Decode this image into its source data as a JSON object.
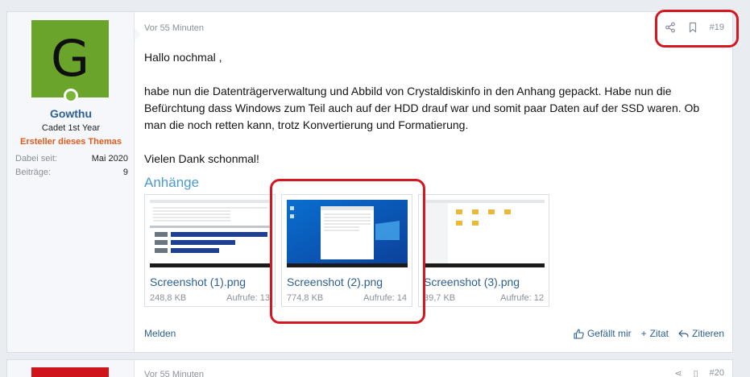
{
  "post": {
    "time": "Vor 55 Minuten",
    "number": "#19",
    "user": {
      "avatar_letter": "G",
      "name": "Gowthu",
      "title": "Cadet 1st Year",
      "badge": "Ersteller dieses Themas",
      "stats": [
        {
          "key": "Dabei seit:",
          "value": "Mai 2020"
        },
        {
          "key": "Beiträge:",
          "value": "9"
        }
      ]
    },
    "message": {
      "line1": "Hallo nochmal ,",
      "line2": "habe nun die Datenträgerverwaltung und Abbild von Crystaldiskinfo in den Anhang gepackt. Habe nun die Befürchtung dass Windows zum Teil auch auf der HDD drauf war und somit paar Daten auf der SSD waren. Ob man die noch retten kann, trotz Konvertierung und Formatierung.",
      "line3": "Vielen Dank schonmal!"
    },
    "attachments_title": "Anhänge",
    "attachments": [
      {
        "name": "Screenshot (1).png",
        "size": "248,8 KB",
        "views": "Aufrufe: 13"
      },
      {
        "name": "Screenshot (2).png",
        "size": "774,8 KB",
        "views": "Aufrufe: 14"
      },
      {
        "name": "Screenshot (3).png",
        "size": "39,7 KB",
        "views": "Aufrufe: 12"
      }
    ],
    "footer": {
      "report": "Melden",
      "like": "Gefällt mir",
      "quote": "Zitat",
      "reply": "Zitieren"
    }
  },
  "next_post": {
    "time": "Vor 55 Minuten",
    "number": "#20"
  },
  "colors": {
    "accent": "#2d5f91",
    "highlight_box": "#d5171f",
    "badge": "#e05a1e",
    "avatar_bg": "#6aa42a"
  }
}
